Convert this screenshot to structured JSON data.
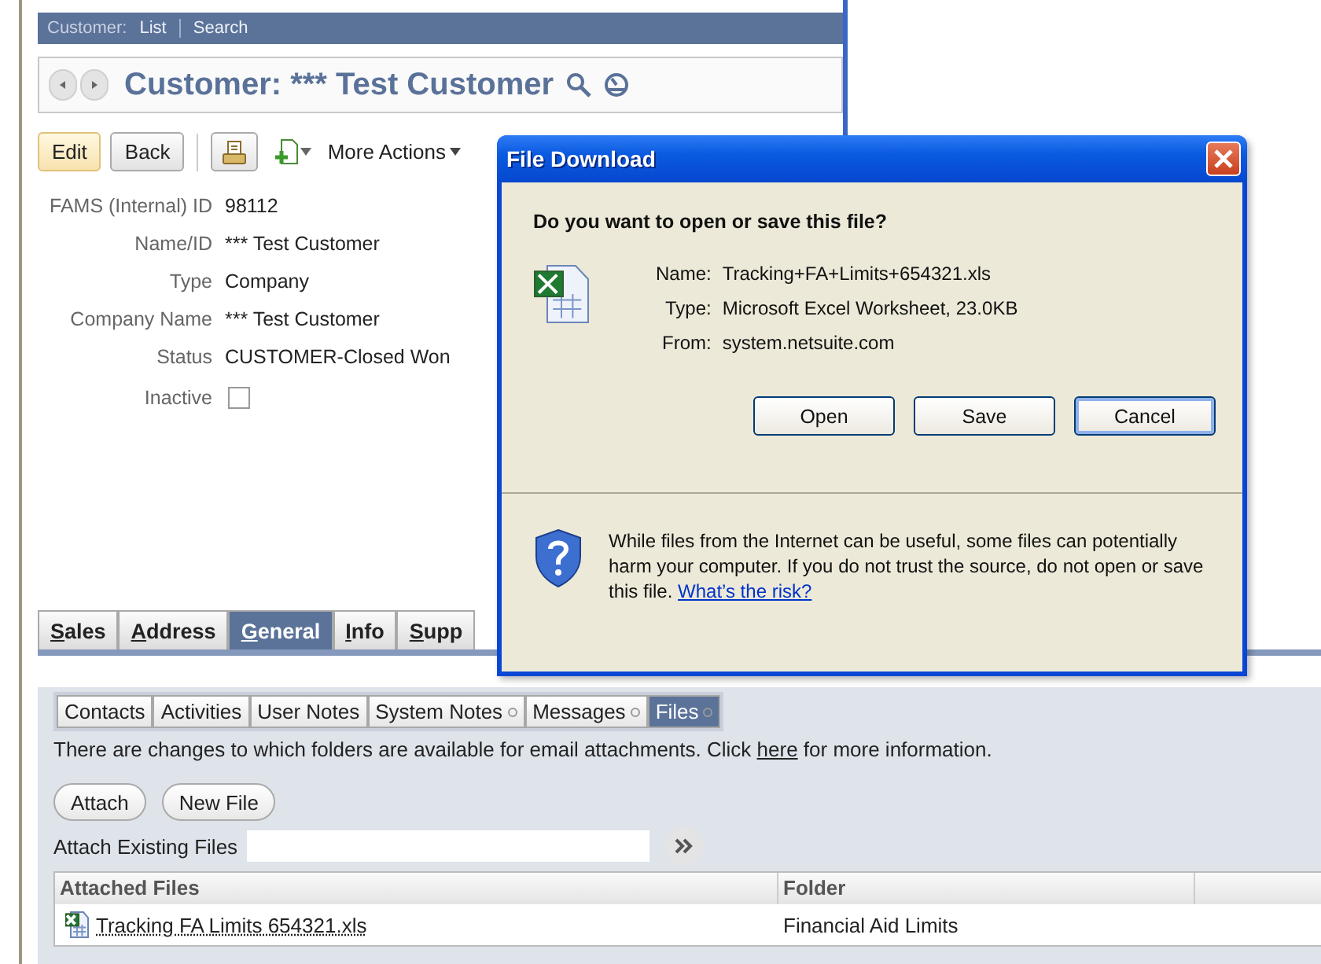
{
  "nav": {
    "label": "Customer:",
    "links": [
      "List",
      "Search"
    ]
  },
  "record": {
    "title": "Customer: *** Test Customer"
  },
  "actions": {
    "buttons": [
      {
        "label": "Edit",
        "kind": "primary"
      },
      {
        "label": "Back",
        "kind": "normal"
      }
    ],
    "more_actions": "More Actions"
  },
  "fields": [
    {
      "label": "FAMS (Internal) ID",
      "value": "98112"
    },
    {
      "label": "Name/ID",
      "value": "*** Test Customer"
    },
    {
      "label": "Type",
      "value": "Company"
    },
    {
      "label": "Company Name",
      "value": "*** Test Customer"
    },
    {
      "label": "Status",
      "value": "CUSTOMER-Closed Won"
    }
  ],
  "inactive": {
    "label": "Inactive",
    "checked": false
  },
  "tabs": [
    {
      "label": "Sales",
      "selected": false
    },
    {
      "label": "Address",
      "selected": false
    },
    {
      "label": "General",
      "selected": true
    },
    {
      "label": "Info",
      "selected": false
    },
    {
      "label": "Supp",
      "selected": false
    }
  ],
  "subtabs": [
    {
      "label": "Contacts",
      "selected": false,
      "indicator": false
    },
    {
      "label": "Activities",
      "selected": false,
      "indicator": false
    },
    {
      "label": "User Notes",
      "selected": false,
      "indicator": false
    },
    {
      "label": "System Notes",
      "selected": false,
      "indicator": true
    },
    {
      "label": "Messages",
      "selected": false,
      "indicator": true
    },
    {
      "label": "Files",
      "selected": true,
      "indicator": true
    }
  ],
  "notice": {
    "before": "There are changes to which folders are available for email attachments. Click ",
    "link": "here",
    "after": " for more information."
  },
  "file_buttons": [
    "Attach",
    "New File"
  ],
  "attach_existing": {
    "label": "Attach Existing Files"
  },
  "table": {
    "columns": [
      "Attached Files",
      "Folder"
    ],
    "rows": [
      {
        "file": "Tracking FA Limits 654321.xls",
        "folder": "Financial Aid Limits"
      }
    ]
  },
  "dialog": {
    "title": "File Download",
    "question": "Do you want to open or save this file?",
    "details": [
      {
        "label": "Name:",
        "value": "Tracking+FA+Limits+654321.xls"
      },
      {
        "label": "Type:",
        "value": "Microsoft Excel Worksheet, 23.0KB"
      },
      {
        "label": "From:",
        "value": "system.netsuite.com"
      }
    ],
    "buttons": [
      {
        "label": "Open",
        "focused": false
      },
      {
        "label": "Save",
        "focused": false
      },
      {
        "label": "Cancel",
        "focused": true
      }
    ],
    "warning": "While files from the Internet can be useful, some files can potentially harm your computer. If you do not trust the source, do not open or save this file. ",
    "warning_link": "What’s the risk?"
  }
}
